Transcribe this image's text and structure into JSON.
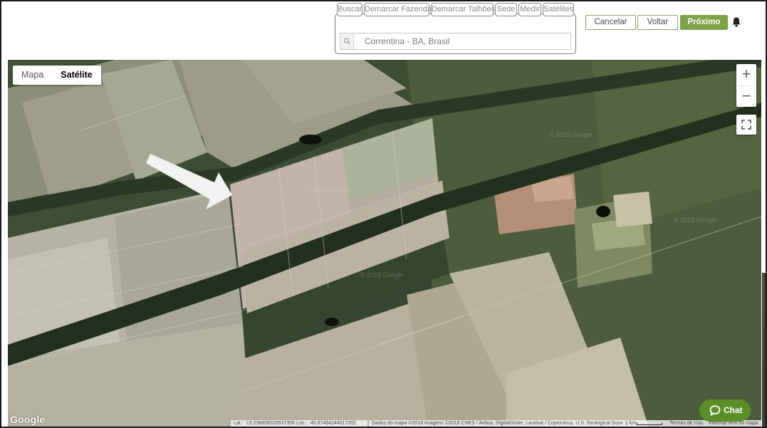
{
  "toolbar": {
    "tools": [
      {
        "label": "Buscar"
      },
      {
        "label": "Demarcar Fazenda"
      },
      {
        "label": "Demarcar Talhões"
      },
      {
        "label": "Sede"
      },
      {
        "label": "Medir"
      },
      {
        "label": "Satélites"
      }
    ],
    "search": {
      "value": "Correntina - BA, Brasil",
      "icon": "search-icon"
    },
    "actions": {
      "cancel": "Cancelar",
      "back": "Voltar",
      "next": "Próximo"
    },
    "notification_icon": "bell-icon",
    "accent_color": "#7da24a"
  },
  "map": {
    "type_control": {
      "options": [
        "Mapa",
        "Satélite"
      ],
      "selected": "Satélite"
    },
    "zoom_in": "+",
    "zoom_out": "−",
    "fullscreen_icon": "fullscreen-icon",
    "logo": "Google",
    "watermark": "© 2018 Google",
    "coords": "Lat.: -13.238808326537356 Lon.: -45.67464244017202",
    "attribution": "Dados do mapa ©2018 Imagens ©2018 CNES / Airbus, DigitalGlobe, Landsat / Copernicus, U.S. Geological Survey",
    "scale": "1 km",
    "terms": "Termos de Uso",
    "report": "Informar erro no mapa",
    "annotation_icon": "arrow-icon",
    "imagery": "satellite"
  },
  "chat": {
    "label": "Chat",
    "icon": "chat-bubble-icon",
    "color": "#5b8e27"
  }
}
